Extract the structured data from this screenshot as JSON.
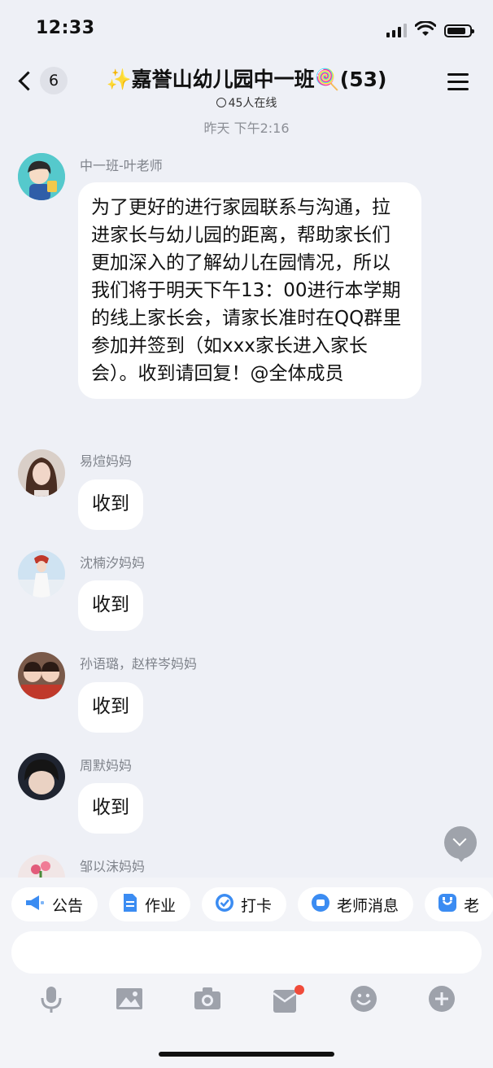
{
  "status": {
    "time": "12:33",
    "battery_level": 0.85
  },
  "nav": {
    "back_count": "6",
    "title": "✨嘉誉山幼儿园中一班🍭(53)",
    "online": "45人在线"
  },
  "timestamp": "昨天 下午2:16",
  "messages": [
    {
      "sender": "中一班-叶老师",
      "text": "为了更好的进行家园联系与沟通，拉进家长与幼儿园的距离，帮助家长们更加深入的了解幼儿在园情况，所以我们将于明天下午13：00进行本学期的线上家长会，请家长准时在QQ群里参加并签到（如xxx家长进入家长会）。收到请回复！@全体成员"
    },
    {
      "sender": "易煊妈妈",
      "text": "收到"
    },
    {
      "sender": "沈楠汐妈妈",
      "text": "收到"
    },
    {
      "sender": "孙语璐，赵梓岑妈妈",
      "text": "收到"
    },
    {
      "sender": "周默妈妈",
      "text": "收到"
    },
    {
      "sender": "邹以沫妈妈",
      "text": ""
    }
  ],
  "quick_actions": [
    {
      "label": "公告",
      "icon": "megaphone-icon"
    },
    {
      "label": "作业",
      "icon": "document-icon"
    },
    {
      "label": "打卡",
      "icon": "checkin-icon"
    },
    {
      "label": "老师消息",
      "icon": "teacher-message-icon"
    },
    {
      "label": "老",
      "icon": "smile-badge-icon"
    }
  ],
  "toolbar": [
    "microphone-icon",
    "image-icon",
    "camera-icon",
    "red-packet-icon",
    "emoji-icon",
    "plus-icon"
  ],
  "colors": {
    "background": "#eef0f6",
    "accent_blue": "#3b8cf2",
    "notify_dot": "#f04b3a"
  }
}
